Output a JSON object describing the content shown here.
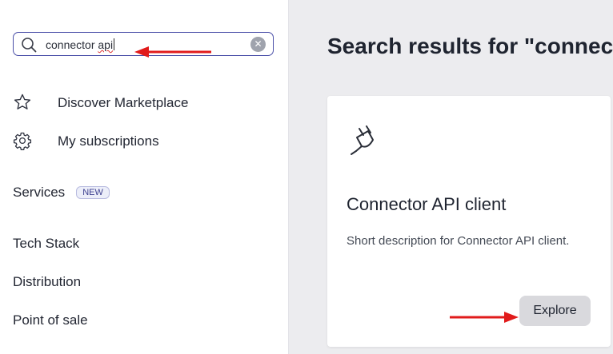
{
  "sidebar": {
    "search": {
      "value_main": "connector ",
      "value_flagged": "api",
      "clear_symbol": "✕"
    },
    "nav": [
      {
        "label": "Discover Marketplace",
        "icon": "star-icon"
      },
      {
        "label": "My subscriptions",
        "icon": "gear-icon"
      }
    ],
    "services": {
      "label": "Services",
      "badge": "NEW"
    },
    "sections": [
      "Tech Stack",
      "Distribution",
      "Point of sale"
    ]
  },
  "main": {
    "title": "Search results for \"connec",
    "card": {
      "icon": "plug-icon",
      "title": "Connector API client",
      "description": "Short description for Connector API client.",
      "button": "Explore"
    }
  },
  "colors": {
    "accent_border": "#4a4fa8",
    "arrow": "#e11b1b",
    "main_bg": "#ececef",
    "button_bg": "#d9d9dd"
  }
}
